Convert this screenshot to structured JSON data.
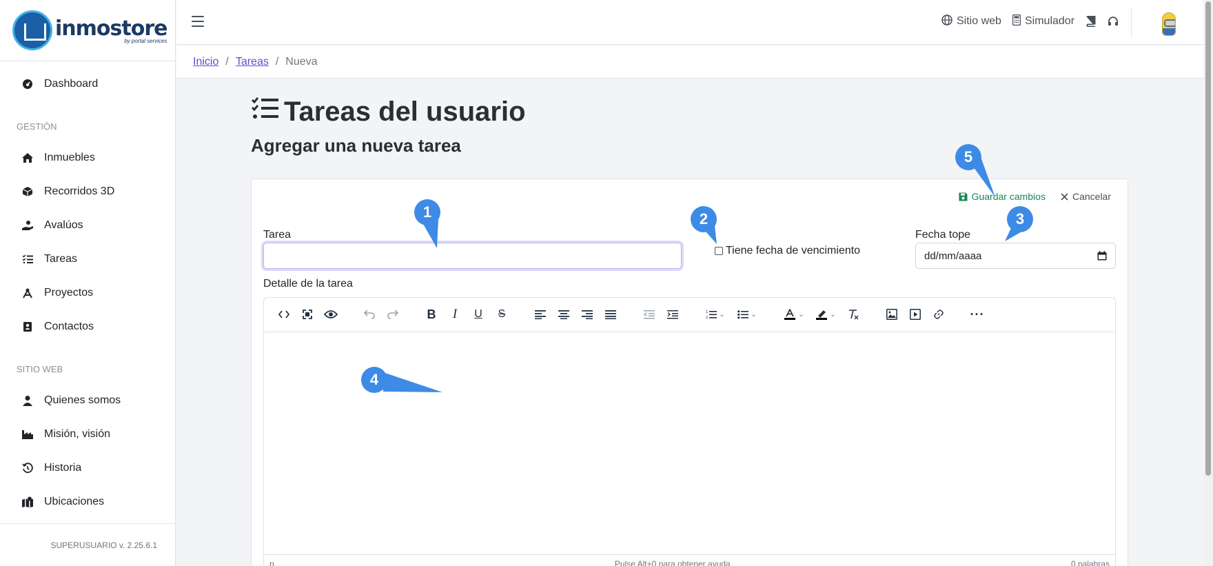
{
  "brand": {
    "name": "inmostore",
    "tagline": "by portal services"
  },
  "sidebar": {
    "dashboard": "Dashboard",
    "section_gestion": "GESTIÓN",
    "gestion_items": [
      "Inmuebles",
      "Recorridos 3D",
      "Avalúos",
      "Tareas",
      "Proyectos",
      "Contactos"
    ],
    "section_sitio": "SITIO WEB",
    "sitio_items": [
      "Quienes somos",
      "Misión, visión",
      "Historia",
      "Ubicaciones"
    ],
    "footer": "SUPERUSUARIO v. 2.25.6.1"
  },
  "topbar": {
    "sitio_web": "Sitio web",
    "simulador": "Simulador"
  },
  "breadcrumb": {
    "home": "Inicio",
    "tasks": "Tareas",
    "current": "Nueva"
  },
  "page": {
    "title": "Tareas del usuario",
    "subtitle": "Agregar una nueva tarea"
  },
  "form": {
    "save_label": "Guardar cambios",
    "cancel_label": "Cancelar",
    "task_label": "Tarea",
    "task_value": "",
    "due_checkbox_label": "Tiene fecha de vencimiento",
    "due_checked": false,
    "deadline_label": "Fecha tope",
    "deadline_placeholder": "dd/mm/aaaa",
    "detail_label": "Detalle de la tarea"
  },
  "editor": {
    "status_left": "p",
    "status_center": "Pulse Alt+0 para obtener ayuda",
    "status_right": "0 palabras"
  },
  "annotations": [
    "1",
    "2",
    "3",
    "4",
    "5"
  ],
  "colors": {
    "accent": "#5a4fcf",
    "save": "#198754",
    "marker": "#3d8be6"
  }
}
